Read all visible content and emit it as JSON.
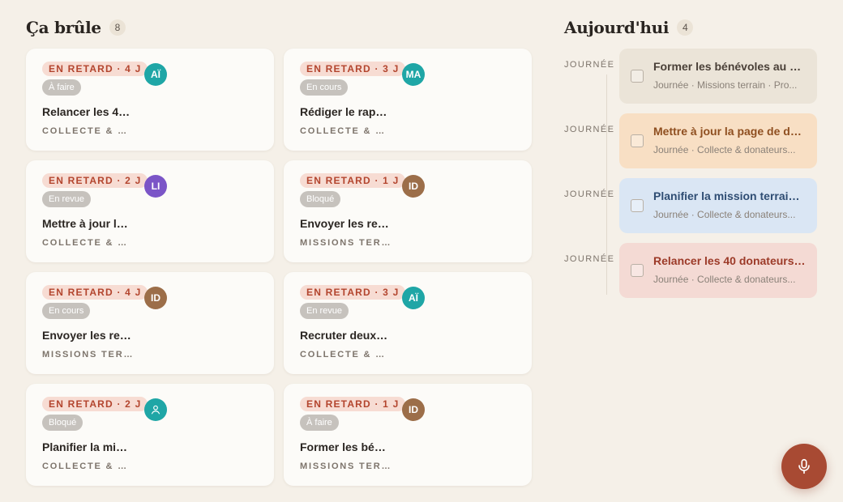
{
  "burning": {
    "title": "Ça brûle",
    "count": "8",
    "cards": [
      {
        "overdue": "EN RETARD · 4 J",
        "status": "À faire",
        "avatar": "AÏ",
        "avatar_color": "#1fa6a6",
        "avatar_icon": false,
        "title": "Relancer les 40 ...",
        "project": "COLLECTE & D..."
      },
      {
        "overdue": "EN RETARD · 3 J",
        "status": "En cours",
        "avatar": "MA",
        "avatar_color": "#1fa6a6",
        "avatar_icon": false,
        "title": "Rédiger le rapp...",
        "project": "COLLECTE & D..."
      },
      {
        "overdue": "EN RETARD · 2 J",
        "status": "En revue",
        "avatar": "LI",
        "avatar_color": "#7b55c7",
        "avatar_icon": false,
        "title": "Mettre à jour la ...",
        "project": "COLLECTE & D..."
      },
      {
        "overdue": "EN RETARD · 1 J",
        "status": "Bloqué",
        "avatar": "ID",
        "avatar_color": "#9c6e49",
        "avatar_icon": false,
        "title": "Envoyer les reçu...",
        "project": "MISSIONS TER..."
      },
      {
        "overdue": "EN RETARD · 4 J",
        "status": "En cours",
        "avatar": "ID",
        "avatar_color": "#9c6e49",
        "avatar_icon": false,
        "title": "Envoyer les reçu...",
        "project": "MISSIONS TER..."
      },
      {
        "overdue": "EN RETARD · 3 J",
        "status": "En revue",
        "avatar": "AÏ",
        "avatar_color": "#1fa6a6",
        "avatar_icon": false,
        "title": "Recruter deux a...",
        "project": "COLLECTE & D..."
      },
      {
        "overdue": "EN RETARD · 2 J",
        "status": "Bloqué",
        "avatar": "",
        "avatar_color": "#1fa6a6",
        "avatar_icon": true,
        "title": "Planifier la missi...",
        "project": "COLLECTE & D..."
      },
      {
        "overdue": "EN RETARD · 1 J",
        "status": "À faire",
        "avatar": "ID",
        "avatar_color": "#9c6e49",
        "avatar_icon": false,
        "title": "Former les béné...",
        "project": "MISSIONS TER..."
      }
    ]
  },
  "today": {
    "title": "Aujourd'hui",
    "count": "4",
    "items": [
      {
        "slot": "JOURNÉE",
        "title": "Former les bénévoles au no...",
        "meta": "Journée · Missions terrain · Pro...",
        "bg": "#ebe4d8",
        "title_color": "#4a4038"
      },
      {
        "slot": "JOURNÉE",
        "title": "Mettre à jour la page de do...",
        "meta": "Journée · Collecte & donateurs...",
        "bg": "#f8dfc4",
        "title_color": "#8f4f20"
      },
      {
        "slot": "JOURNÉE",
        "title": "Planifier la mission terrain d...",
        "meta": "Journée · Collecte & donateurs...",
        "bg": "#dae6f4",
        "title_color": "#2f4d73"
      },
      {
        "slot": "JOURNÉE",
        "title": "Relancer les 40 donateurs ...",
        "meta": "Journée · Collecte & donateurs...",
        "bg": "#f4dad4",
        "title_color": "#9c3a28"
      }
    ]
  },
  "icons": {
    "mic": "microphone-icon",
    "person": "person-icon"
  },
  "colors": {
    "accent": "#a84a33",
    "overdue_text": "#b3452e",
    "overdue_bg": "#f7dcd3",
    "status_bg": "#c6c2bd"
  }
}
